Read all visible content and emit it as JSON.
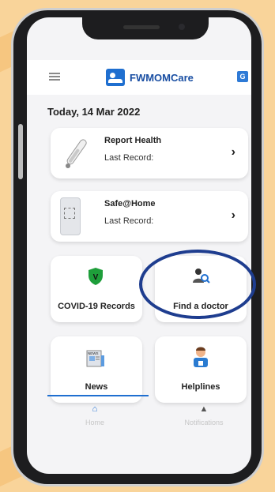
{
  "app": {
    "name": "FWMOMCare"
  },
  "date_label": "Today, 14 Mar 2022",
  "cards": [
    {
      "title": "Report Health",
      "subtitle": "Last Record:"
    },
    {
      "title": "Safe@Home",
      "subtitle": "Last Record:"
    }
  ],
  "tiles": [
    {
      "label": "COVID-19 Records",
      "icon": "shield-v-icon"
    },
    {
      "label": "Find a doctor",
      "icon": "doctor-search-icon"
    },
    {
      "label": "News",
      "icon": "news-icon"
    },
    {
      "label": "Helplines",
      "icon": "helpline-person-icon"
    }
  ],
  "bottom_nav": [
    {
      "label": "Home",
      "active": true
    },
    {
      "label": "Notifications",
      "active": false
    }
  ],
  "colors": {
    "brand_blue": "#1f6fd0",
    "highlight_ring": "#1e3d8f",
    "shield_green": "#1e9e3a",
    "background": "#f9d49a"
  }
}
